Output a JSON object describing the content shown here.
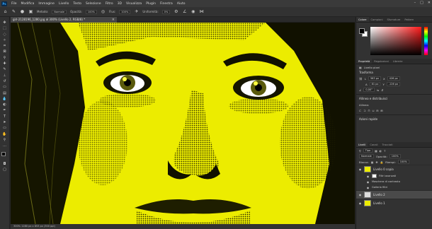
{
  "menu": {
    "logo": "Ps",
    "items": [
      "File",
      "Modifica",
      "Immagine",
      "Livello",
      "Testo",
      "Selezione",
      "Filtro",
      "3D",
      "Visualizza",
      "Plugin",
      "Finestra",
      "Aiuto"
    ],
    "window_controls": [
      "–",
      "□",
      "✕"
    ]
  },
  "options": {
    "metodo_label": "Metodo:",
    "metodo_value": "Normale",
    "opacita_label": "Opacità:",
    "opacita_value": "100%",
    "flusso_label": "Flus:",
    "flusso_value": "100%",
    "uniformita_label": "Uniformità:",
    "uniformita_value": "0%"
  },
  "document": {
    "tab_title": "girl-2128196_1280.jpg al 300% (Livello 2, RGB/8) *",
    "close": "×",
    "status": "300%   1280 px x 853 px (300 ppi)"
  },
  "color_panel": {
    "tabs": [
      "Colore",
      "Campioni",
      "Sfumature",
      "Pattern"
    ]
  },
  "properties_panel": {
    "tabs": [
      "Proprietà",
      "Regolazioni",
      "Librerie"
    ],
    "layer_kind": "Livello pixel",
    "transform_title": "Trasforma",
    "w_label": "L",
    "w_value": "563 px",
    "x_label": "X",
    "x_value": "426 px",
    "h_label": "A",
    "h_value": "81 px",
    "y_value": "-126 px",
    "angle_value": "0,00°",
    "align_title": "Allinea e distribuisci",
    "align_sub": "Allinea:",
    "quick_actions": "Azioni rapide"
  },
  "layers_panel": {
    "tabs": [
      "Livelli",
      "Canali",
      "Tracciati"
    ],
    "kind_label": "Tipo",
    "blend_mode": "Normale",
    "opacity_label": "Opacità:",
    "opacity_value": "100%",
    "lock_label": "Blocca:",
    "fill_label": "Riempi:",
    "fill_value": "100%",
    "layers": [
      {
        "name": "Livello 0 copia",
        "visible": true
      },
      {
        "name": "Filtri avanzati",
        "visible": true
      },
      {
        "name": "Maschera di contrasto",
        "visible": true
      },
      {
        "name": "Galleria filtri",
        "visible": true
      },
      {
        "name": "Livello 2",
        "visible": true
      },
      {
        "name": "Livello 1",
        "visible": true
      }
    ]
  },
  "colors": {
    "accent_yellow": "#ecec00",
    "ps_blue": "#31a8ff"
  }
}
